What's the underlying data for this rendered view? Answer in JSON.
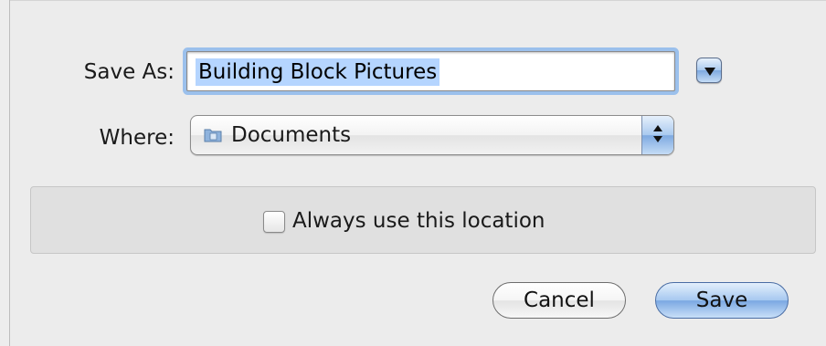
{
  "dialog": {
    "save_as_label": "Save As:",
    "file_name": "Building Block Pictures",
    "where_label": "Where:",
    "location": "Documents",
    "always_use_label": "Always use this location",
    "always_use_checked": false,
    "cancel_label": "Cancel",
    "save_label": "Save"
  },
  "colors": {
    "accent": "#7aa8e2",
    "selection": "#b5d5ff",
    "background": "#ececec"
  },
  "icons": {
    "expand": "disclosure-triangle-down",
    "location": "folder-icon",
    "stepper": "up-down-arrows"
  }
}
